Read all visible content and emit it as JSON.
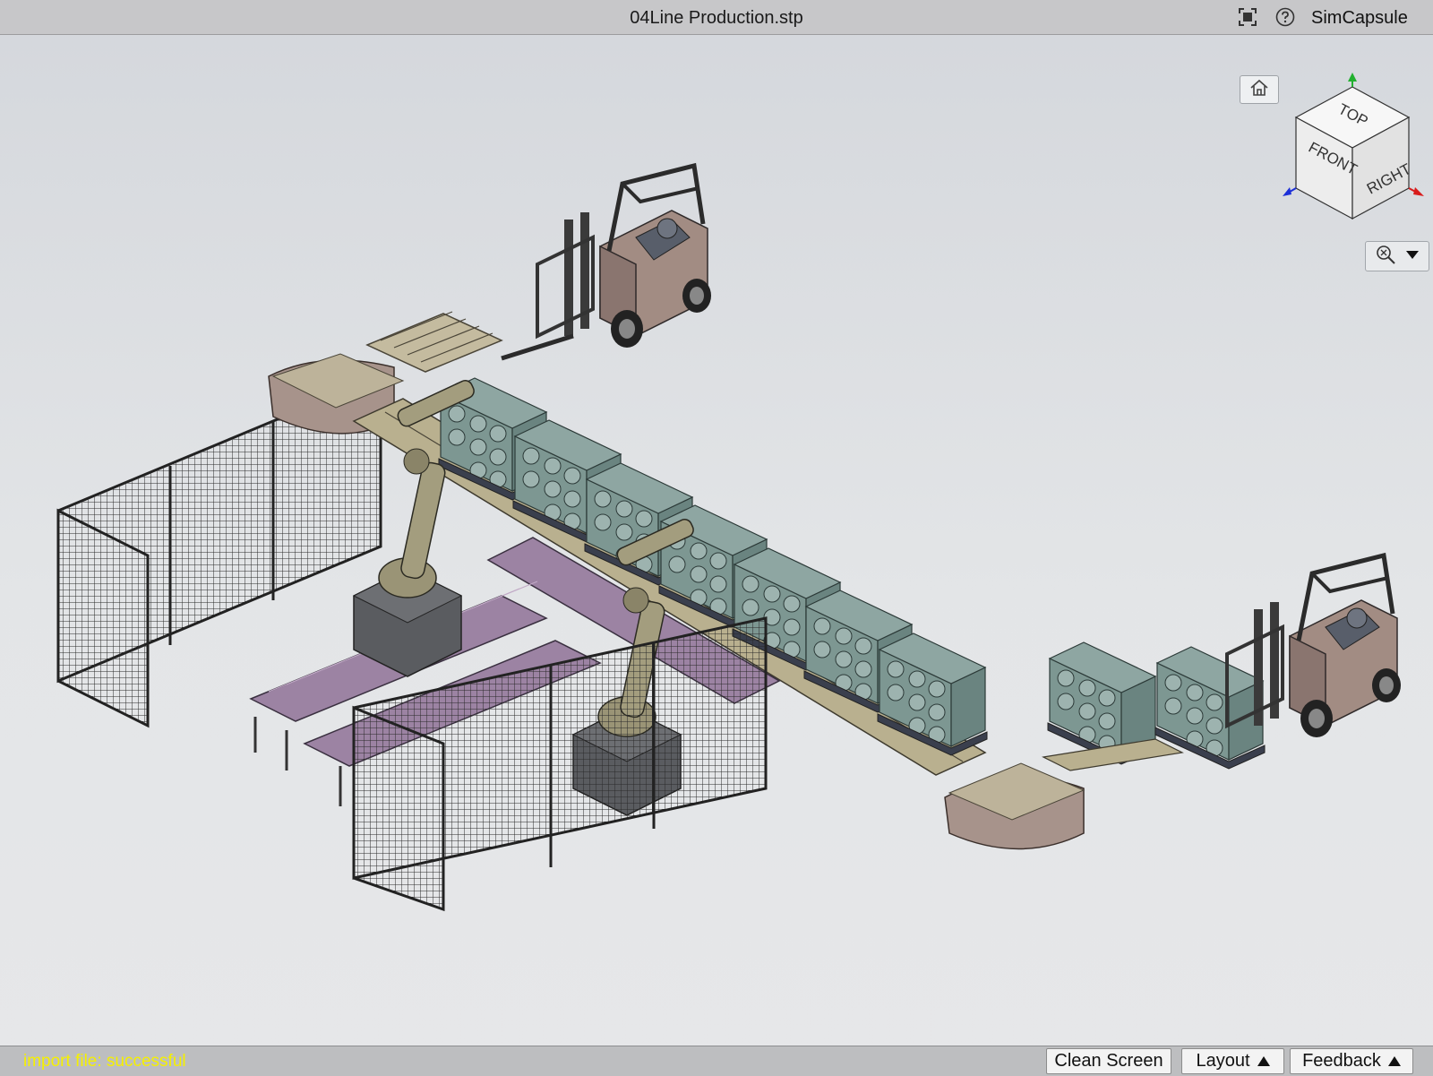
{
  "window": {
    "title": "04Line Production.stp",
    "brand": "SimCapsule"
  },
  "toolbar": {
    "fullscreen_icon": "fullscreen-icon",
    "help_icon": "help-icon"
  },
  "viewport": {
    "home_icon": "home-icon",
    "viewcube": {
      "top": "TOP",
      "front": "FRONT",
      "right": "RIGHT"
    },
    "zoom_icon": "zoom-fit-icon"
  },
  "status": {
    "message": "import file: successful",
    "clean_screen": "Clean Screen",
    "layout": "Layout",
    "feedback": "Feedback"
  },
  "colors": {
    "status_text": "#f5f000",
    "conveyor_purple": "#9c83a3",
    "crate_green": "#6f8a86",
    "axis_x": "#d81c1c",
    "axis_y": "#22b02f",
    "axis_z": "#1c2fd8"
  }
}
